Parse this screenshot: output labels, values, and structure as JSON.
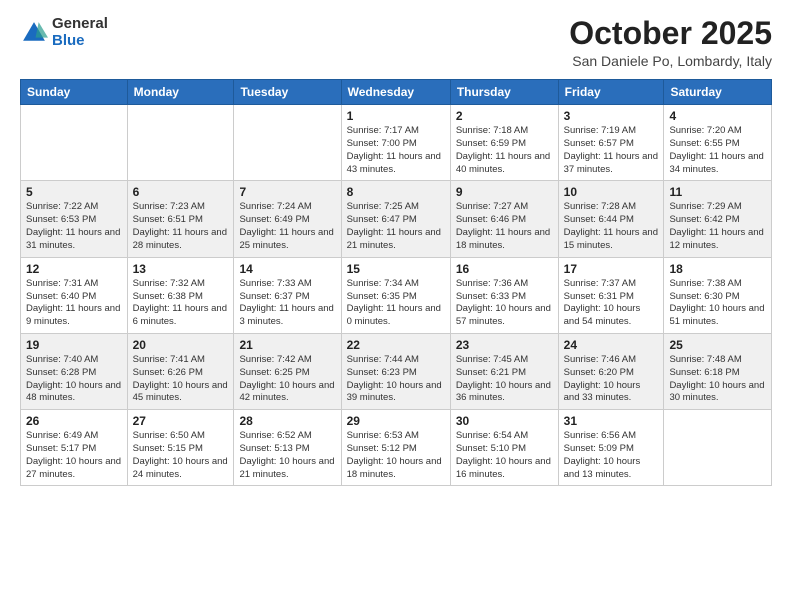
{
  "header": {
    "logo": {
      "general": "General",
      "blue": "Blue"
    },
    "title": "October 2025",
    "location": "San Daniele Po, Lombardy, Italy"
  },
  "days_of_week": [
    "Sunday",
    "Monday",
    "Tuesday",
    "Wednesday",
    "Thursday",
    "Friday",
    "Saturday"
  ],
  "weeks": [
    [
      {
        "day": "",
        "info": ""
      },
      {
        "day": "",
        "info": ""
      },
      {
        "day": "",
        "info": ""
      },
      {
        "day": "1",
        "info": "Sunrise: 7:17 AM\nSunset: 7:00 PM\nDaylight: 11 hours and 43 minutes."
      },
      {
        "day": "2",
        "info": "Sunrise: 7:18 AM\nSunset: 6:59 PM\nDaylight: 11 hours and 40 minutes."
      },
      {
        "day": "3",
        "info": "Sunrise: 7:19 AM\nSunset: 6:57 PM\nDaylight: 11 hours and 37 minutes."
      },
      {
        "day": "4",
        "info": "Sunrise: 7:20 AM\nSunset: 6:55 PM\nDaylight: 11 hours and 34 minutes."
      }
    ],
    [
      {
        "day": "5",
        "info": "Sunrise: 7:22 AM\nSunset: 6:53 PM\nDaylight: 11 hours and 31 minutes."
      },
      {
        "day": "6",
        "info": "Sunrise: 7:23 AM\nSunset: 6:51 PM\nDaylight: 11 hours and 28 minutes."
      },
      {
        "day": "7",
        "info": "Sunrise: 7:24 AM\nSunset: 6:49 PM\nDaylight: 11 hours and 25 minutes."
      },
      {
        "day": "8",
        "info": "Sunrise: 7:25 AM\nSunset: 6:47 PM\nDaylight: 11 hours and 21 minutes."
      },
      {
        "day": "9",
        "info": "Sunrise: 7:27 AM\nSunset: 6:46 PM\nDaylight: 11 hours and 18 minutes."
      },
      {
        "day": "10",
        "info": "Sunrise: 7:28 AM\nSunset: 6:44 PM\nDaylight: 11 hours and 15 minutes."
      },
      {
        "day": "11",
        "info": "Sunrise: 7:29 AM\nSunset: 6:42 PM\nDaylight: 11 hours and 12 minutes."
      }
    ],
    [
      {
        "day": "12",
        "info": "Sunrise: 7:31 AM\nSunset: 6:40 PM\nDaylight: 11 hours and 9 minutes."
      },
      {
        "day": "13",
        "info": "Sunrise: 7:32 AM\nSunset: 6:38 PM\nDaylight: 11 hours and 6 minutes."
      },
      {
        "day": "14",
        "info": "Sunrise: 7:33 AM\nSunset: 6:37 PM\nDaylight: 11 hours and 3 minutes."
      },
      {
        "day": "15",
        "info": "Sunrise: 7:34 AM\nSunset: 6:35 PM\nDaylight: 11 hours and 0 minutes."
      },
      {
        "day": "16",
        "info": "Sunrise: 7:36 AM\nSunset: 6:33 PM\nDaylight: 10 hours and 57 minutes."
      },
      {
        "day": "17",
        "info": "Sunrise: 7:37 AM\nSunset: 6:31 PM\nDaylight: 10 hours and 54 minutes."
      },
      {
        "day": "18",
        "info": "Sunrise: 7:38 AM\nSunset: 6:30 PM\nDaylight: 10 hours and 51 minutes."
      }
    ],
    [
      {
        "day": "19",
        "info": "Sunrise: 7:40 AM\nSunset: 6:28 PM\nDaylight: 10 hours and 48 minutes."
      },
      {
        "day": "20",
        "info": "Sunrise: 7:41 AM\nSunset: 6:26 PM\nDaylight: 10 hours and 45 minutes."
      },
      {
        "day": "21",
        "info": "Sunrise: 7:42 AM\nSunset: 6:25 PM\nDaylight: 10 hours and 42 minutes."
      },
      {
        "day": "22",
        "info": "Sunrise: 7:44 AM\nSunset: 6:23 PM\nDaylight: 10 hours and 39 minutes."
      },
      {
        "day": "23",
        "info": "Sunrise: 7:45 AM\nSunset: 6:21 PM\nDaylight: 10 hours and 36 minutes."
      },
      {
        "day": "24",
        "info": "Sunrise: 7:46 AM\nSunset: 6:20 PM\nDaylight: 10 hours and 33 minutes."
      },
      {
        "day": "25",
        "info": "Sunrise: 7:48 AM\nSunset: 6:18 PM\nDaylight: 10 hours and 30 minutes."
      }
    ],
    [
      {
        "day": "26",
        "info": "Sunrise: 6:49 AM\nSunset: 5:17 PM\nDaylight: 10 hours and 27 minutes."
      },
      {
        "day": "27",
        "info": "Sunrise: 6:50 AM\nSunset: 5:15 PM\nDaylight: 10 hours and 24 minutes."
      },
      {
        "day": "28",
        "info": "Sunrise: 6:52 AM\nSunset: 5:13 PM\nDaylight: 10 hours and 21 minutes."
      },
      {
        "day": "29",
        "info": "Sunrise: 6:53 AM\nSunset: 5:12 PM\nDaylight: 10 hours and 18 minutes."
      },
      {
        "day": "30",
        "info": "Sunrise: 6:54 AM\nSunset: 5:10 PM\nDaylight: 10 hours and 16 minutes."
      },
      {
        "day": "31",
        "info": "Sunrise: 6:56 AM\nSunset: 5:09 PM\nDaylight: 10 hours and 13 minutes."
      },
      {
        "day": "",
        "info": ""
      }
    ]
  ]
}
